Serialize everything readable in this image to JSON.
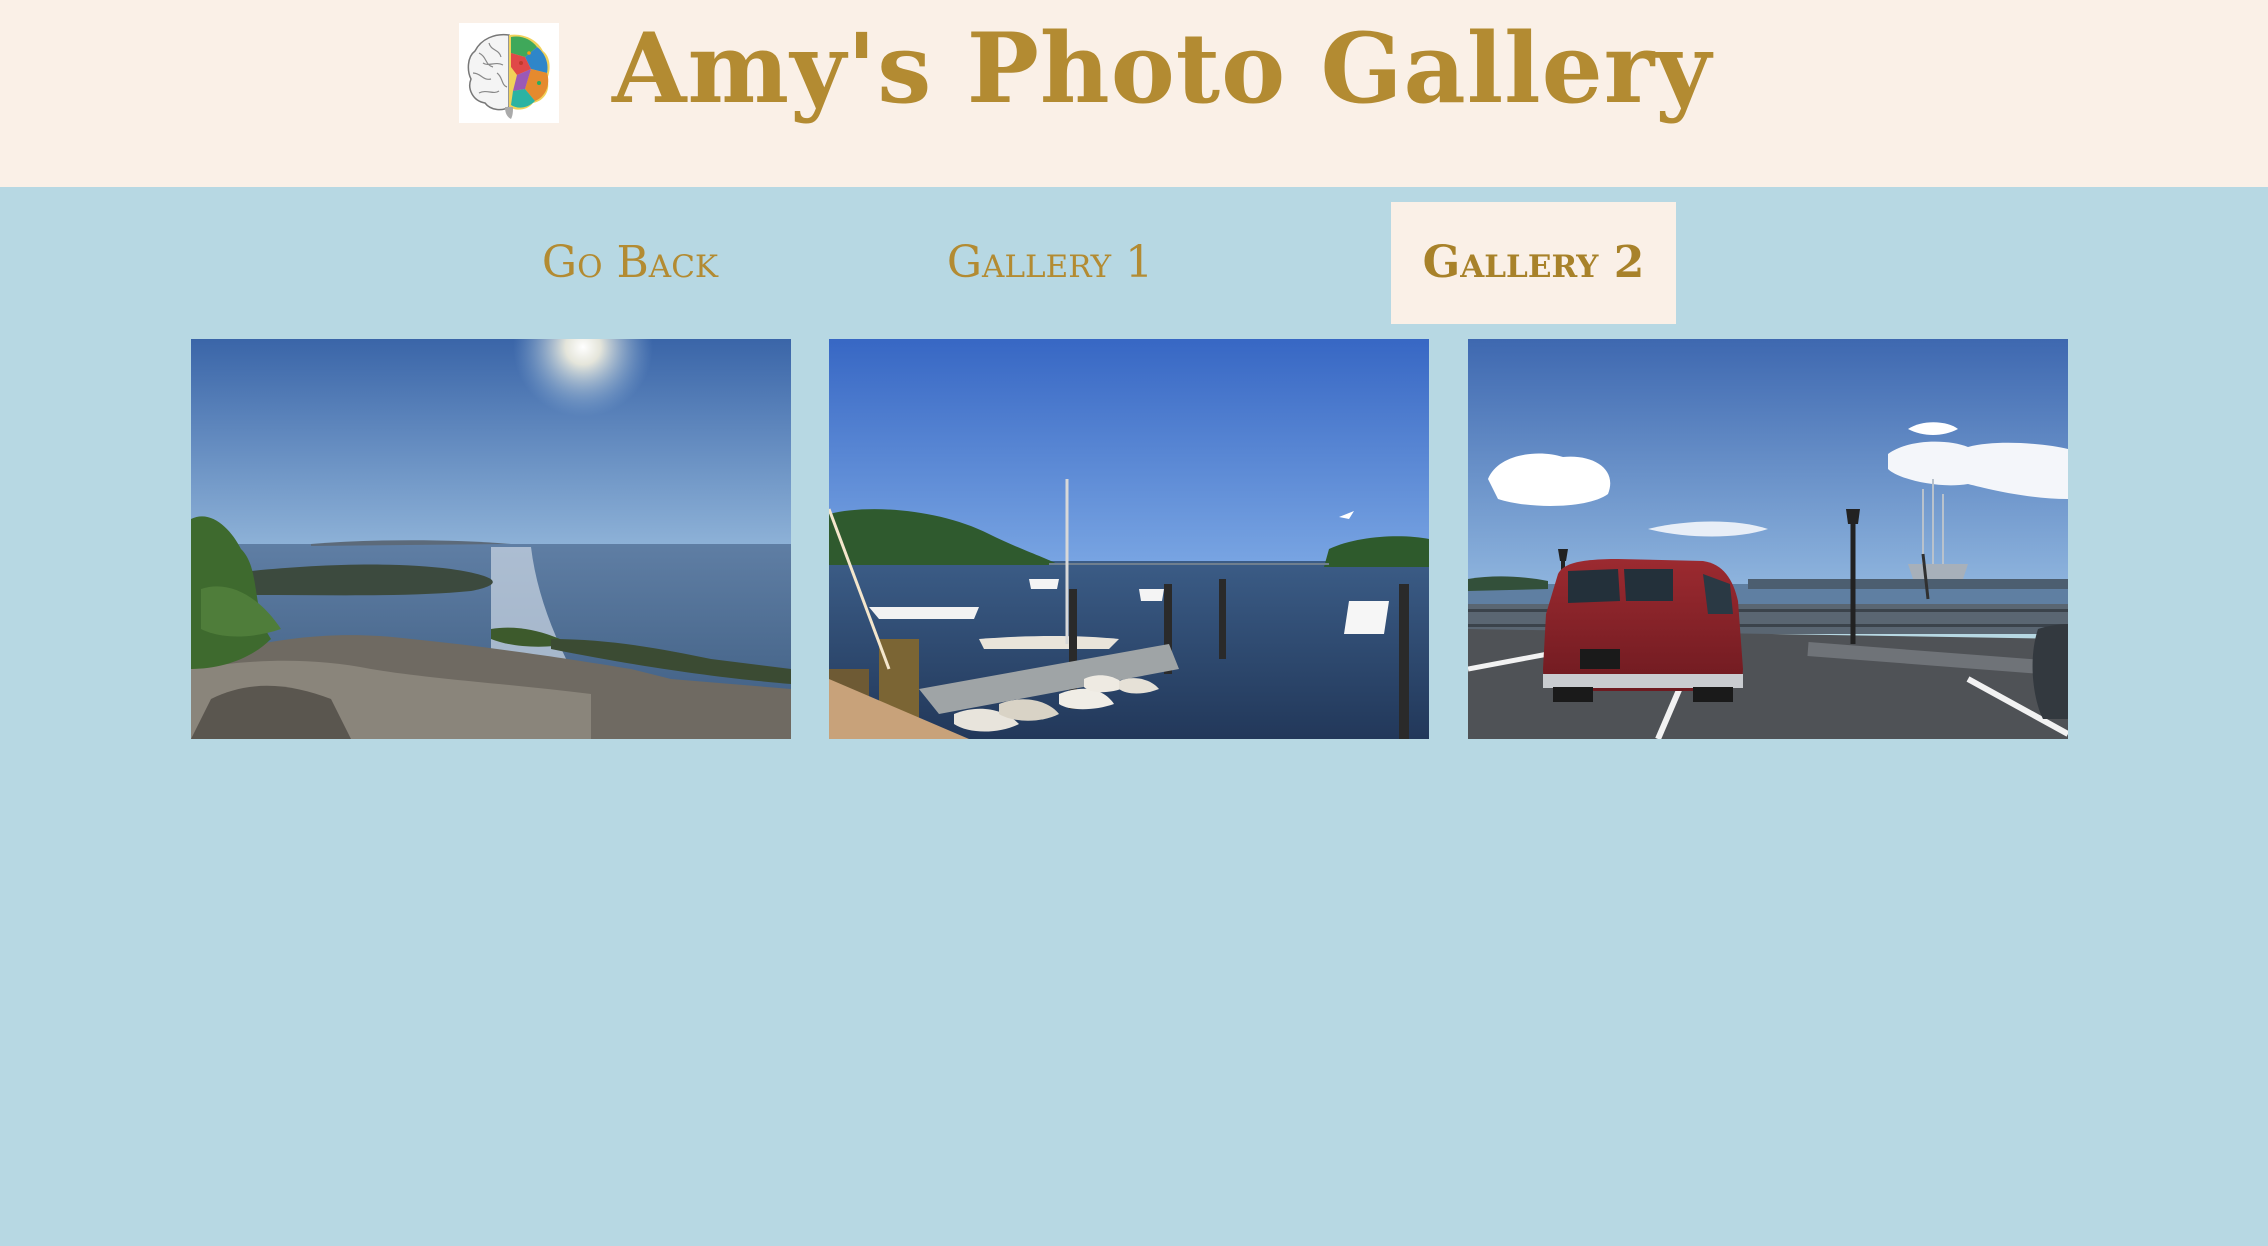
{
  "header": {
    "title": "Amy's Photo Gallery",
    "logo_icon": "brain-icon"
  },
  "nav": {
    "items": [
      {
        "label": "Go Back",
        "active": false
      },
      {
        "label": "Gallery 1",
        "active": false
      },
      {
        "label": "Gallery 2",
        "active": true
      }
    ]
  },
  "gallery": {
    "photos": [
      {
        "subject": "coastal-overlook-photo"
      },
      {
        "subject": "harbor-dock-photo"
      },
      {
        "subject": "parking-lot-van-photo"
      }
    ]
  },
  "colors": {
    "page_background": "#b7d8e3",
    "header_background": "#faf0e7",
    "accent_text": "#b38b32",
    "active_tab_background": "#faf0e7"
  }
}
